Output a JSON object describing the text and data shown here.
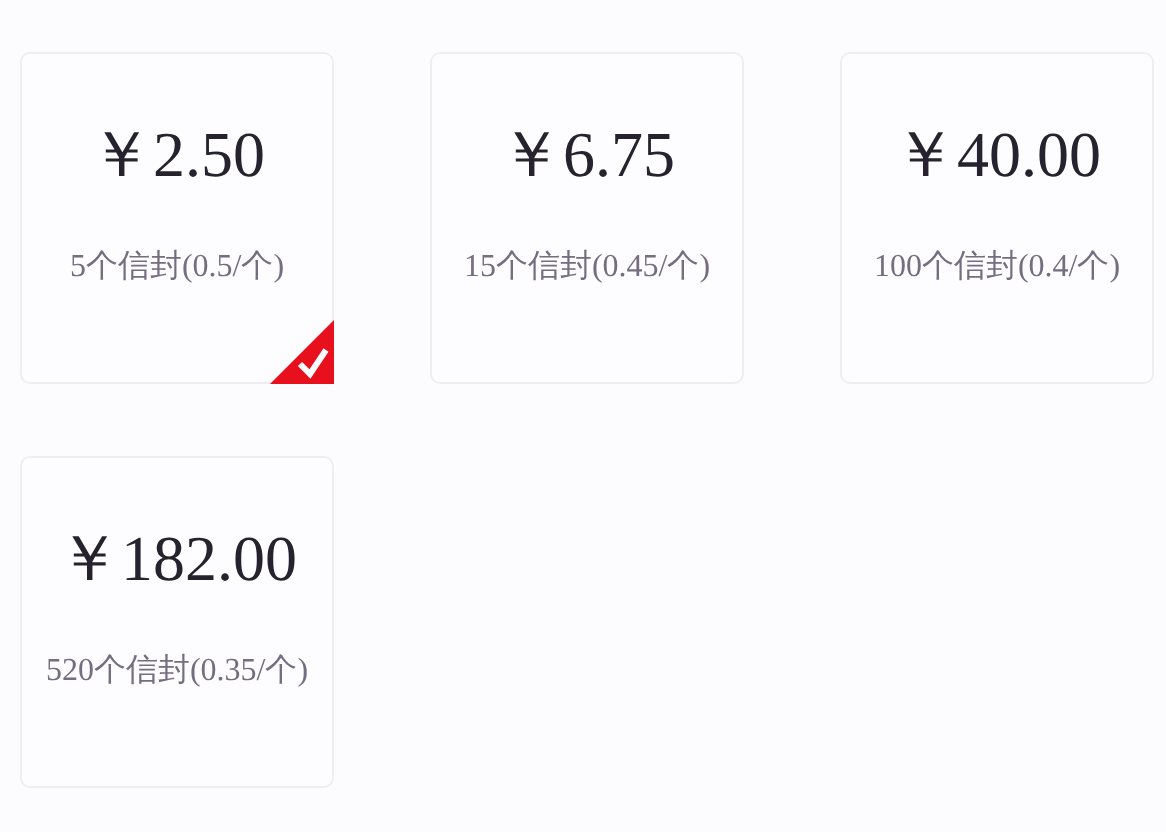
{
  "packages": [
    {
      "price": "￥2.50",
      "detail": "5个信封(0.5/个)",
      "selected": true
    },
    {
      "price": "￥6.75",
      "detail": "15个信封(0.45/个)",
      "selected": false
    },
    {
      "price": "￥40.00",
      "detail": "100个信封(0.4/个)",
      "selected": false
    },
    {
      "price": "￥182.00",
      "detail": "520个信封(0.35/个)",
      "selected": false
    }
  ]
}
